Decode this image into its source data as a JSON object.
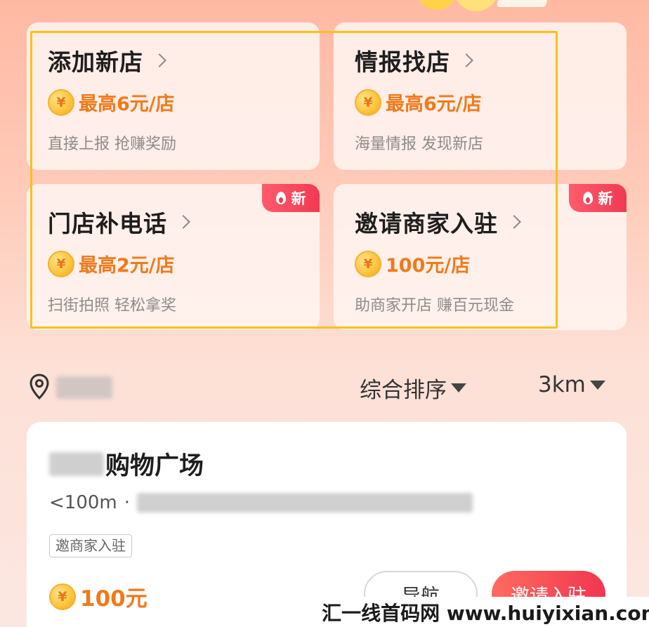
{
  "tasks": [
    {
      "title": "添加新店",
      "reward": "最高6元/店",
      "desc": "直接上报 抢赚奖励",
      "badge": ""
    },
    {
      "title": "情报找店",
      "reward": "最高6元/店",
      "desc": "海量情报 发现新店",
      "badge": ""
    },
    {
      "title": "门店补电话",
      "reward": "最高2元/店",
      "desc": "扫街拍照 轻松拿奖",
      "badge": "新"
    },
    {
      "title": "邀请商家入驻",
      "reward": "100元/店",
      "desc": "助商家开店 赚百元现金",
      "badge": "新"
    }
  ],
  "coin_symbol": "¥",
  "filters": {
    "sort_label": "综合排序",
    "distance_label": "3km"
  },
  "store": {
    "name_suffix": "购物广场",
    "distance": "<100m",
    "tag": "邀商家入驻",
    "reward": "100元",
    "nav_button": "导航",
    "invite_button": "邀请入驻"
  },
  "watermark": "汇一线首码网 www.huiyixian.com",
  "colors": {
    "accent_orange": "#f07a1a",
    "badge_red": "#f03a54",
    "highlight_yellow": "#f7c21a"
  }
}
